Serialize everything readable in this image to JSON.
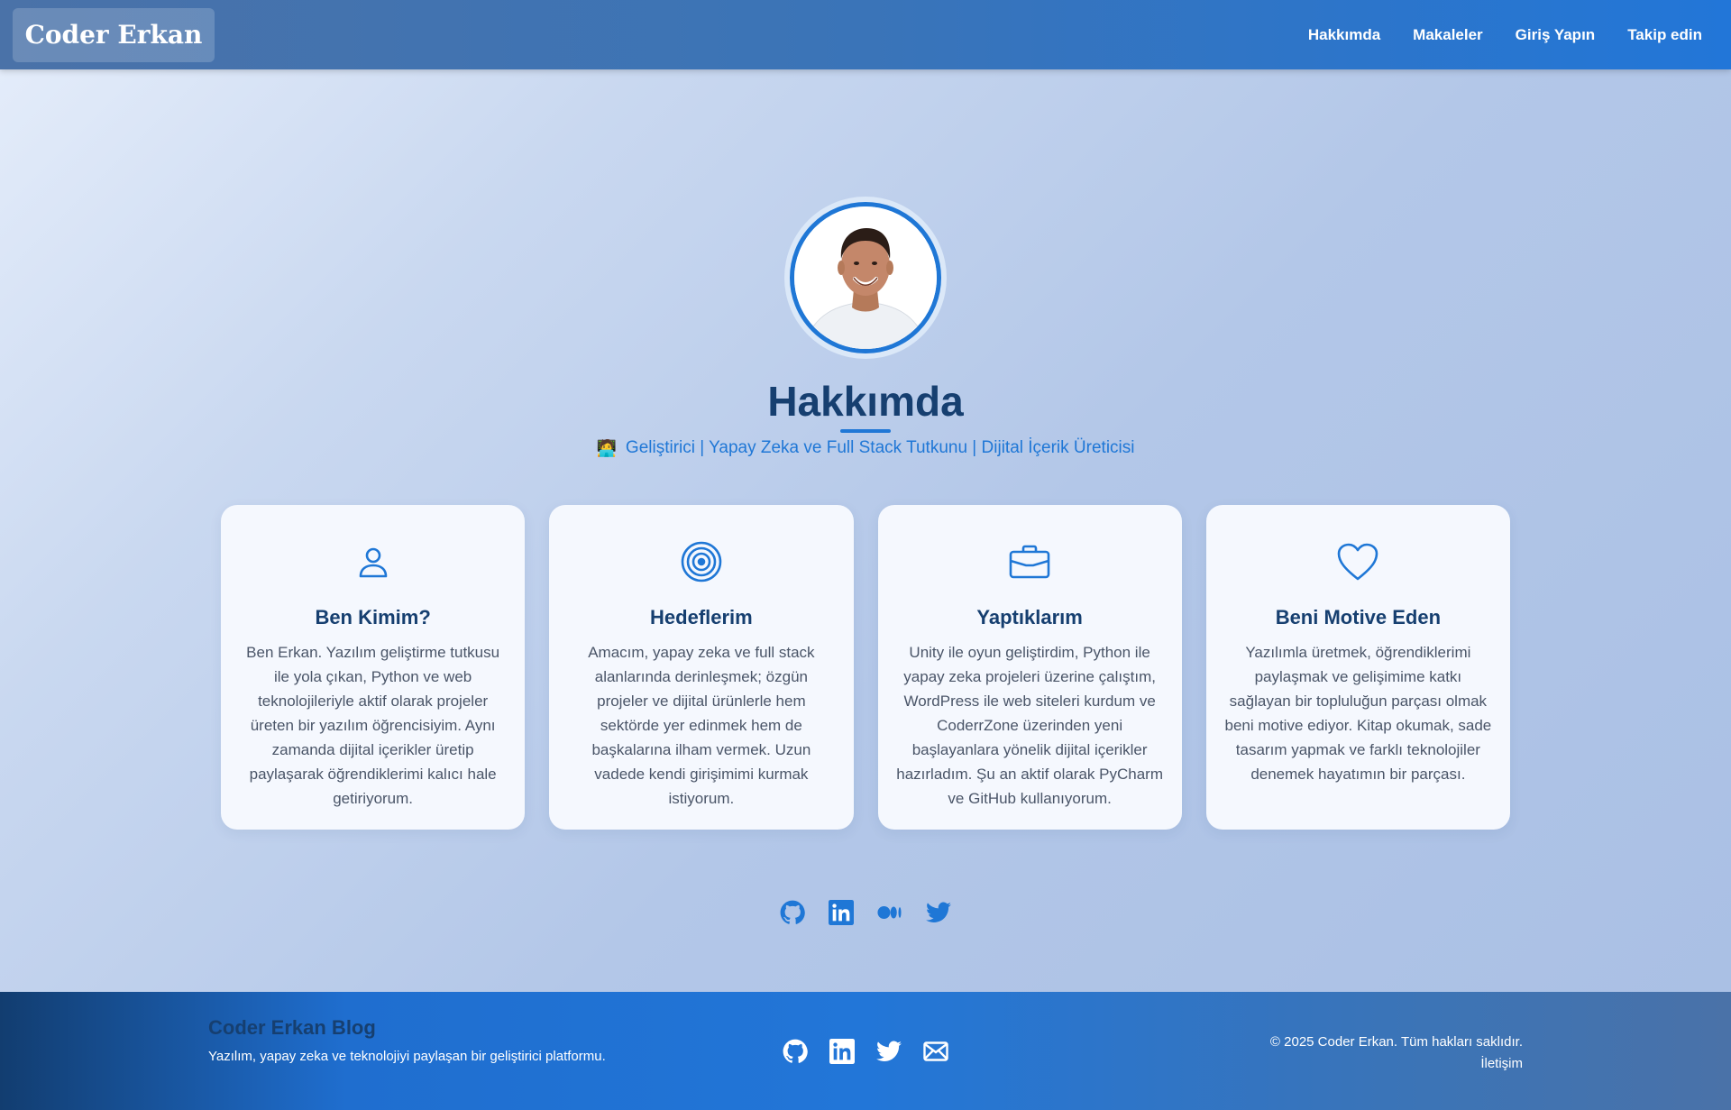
{
  "navbar": {
    "brand": "Coder Erkan",
    "links": [
      "Hakkımda",
      "Makaleler",
      "Giriş Yapın",
      "Takip edin"
    ]
  },
  "hero": {
    "title": "Hakkımda",
    "subtitle": "Geliştirici | Yapay Zeka ve Full Stack Tutkunu | Dijital İçerik Üreticisi",
    "subtitle_icon": "developer-emoji-icon"
  },
  "cards": [
    {
      "icon": "user-icon",
      "title": "Ben Kimim?",
      "text": "Ben Erkan. Yazılım geliştirme tutkusu ile yola çıkan, Python ve web teknolojileriyle aktif olarak projeler üreten bir yazılım öğrencisiyim. Aynı zamanda dijital içerikler üretip paylaşarak öğrendiklerimi kalıcı hale getiriyorum."
    },
    {
      "icon": "target-icon",
      "title": "Hedeflerim",
      "text": "Amacım, yapay zeka ve full stack alanlarında derinleşmek; özgün projeler ve dijital ürünlerle hem sektörde yer edinmek hem de başkalarına ilham vermek. Uzun vadede kendi girişimimi kurmak istiyorum."
    },
    {
      "icon": "briefcase-icon",
      "title": "Yaptıklarım",
      "text": "Unity ile oyun geliştirdim, Python ile yapay zeka projeleri üzerine çalıştım, WordPress ile web siteleri kurdum ve CoderrZone üzerinden yeni başlayanlara yönelik dijital içerikler hazırladım. Şu an aktif olarak PyCharm ve GitHub kullanıyorum."
    },
    {
      "icon": "heart-icon",
      "title": "Beni Motive Eden",
      "text": "Yazılımla üretmek, öğrendiklerimi paylaşmak ve gelişimime katkı sağlayan bir topluluğun parçası olmak beni motive ediyor. Kitap okumak, sade tasarım yapmak ve farklı teknolojiler denemek hayatımın bir parçası."
    }
  ],
  "social": [
    "github-icon",
    "linkedin-icon",
    "medium-icon",
    "twitter-icon"
  ],
  "footer": {
    "brand": "Coder Erkan Blog",
    "tagline": "Yazılım, yapay zeka ve teknolojiyi paylaşan bir geliştirici platformu.",
    "icons": [
      "github-icon",
      "linkedin-icon",
      "twitter-icon",
      "mail-icon"
    ],
    "copyright": "© 2025 Coder Erkan. Tüm hakları saklıdır.",
    "contact": "İletişim"
  },
  "colors": {
    "accent": "#1f77d6",
    "heading": "#163f70"
  }
}
